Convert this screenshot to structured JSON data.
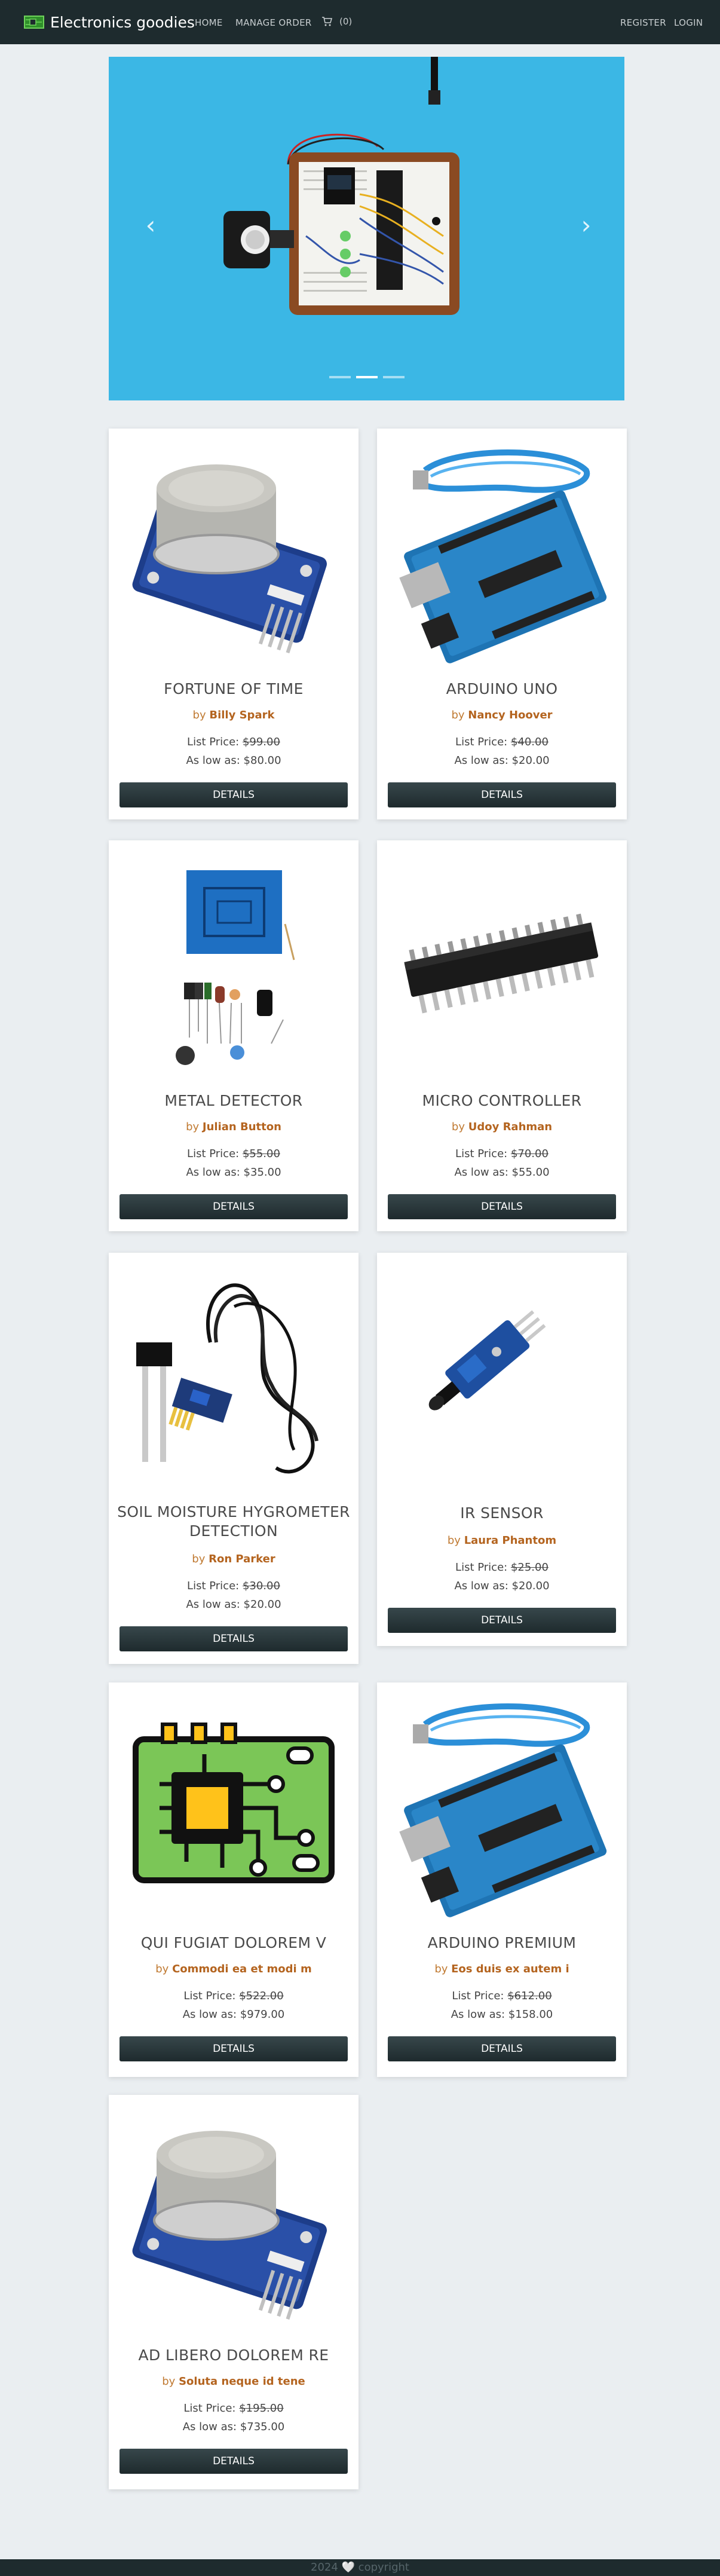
{
  "nav": {
    "brand": "Electronics goodies",
    "home": "HOME",
    "manage_order": "MANAGE ORDER",
    "cart_count": "(0)",
    "register": "REGISTER",
    "login": "LOGIN"
  },
  "carousel": {
    "prev": "‹",
    "next": "›",
    "slides": 3,
    "active_slide": 2
  },
  "products": [
    {
      "title": "FORTUNE OF TIME",
      "by": "by",
      "author": "Billy Spark",
      "list_label": "List Price:",
      "list_price": "$99.00",
      "low_label": "As low as:",
      "low_price": "$80.00",
      "button": "DETAILS",
      "image": "gas-sensor"
    },
    {
      "title": "ARDUINO UNO",
      "by": "by",
      "author": "Nancy Hoover",
      "list_label": "List Price:",
      "list_price": "$40.00",
      "low_label": "As low as:",
      "low_price": "$20.00",
      "button": "DETAILS",
      "image": "arduino-board"
    },
    {
      "title": "METAL DETECTOR",
      "by": "by",
      "author": "Julian Button",
      "list_label": "List Price:",
      "list_price": "$55.00",
      "low_label": "As low as:",
      "low_price": "$35.00",
      "button": "DETAILS",
      "image": "metal-detector-kit"
    },
    {
      "title": "MICRO CONTROLLER",
      "by": "by",
      "author": "Udoy Rahman",
      "list_label": "List Price:",
      "list_price": "$70.00",
      "low_label": "As low as:",
      "low_price": "$55.00",
      "button": "DETAILS",
      "image": "chip"
    },
    {
      "title": "SOIL MOISTURE HYGROMETER DETECTION",
      "by": "by",
      "author": "Ron Parker",
      "list_label": "List Price:",
      "list_price": "$30.00",
      "low_label": "As low as:",
      "low_price": "$20.00",
      "button": "DETAILS",
      "image": "soil-sensor"
    },
    {
      "title": "IR SENSOR",
      "by": "by",
      "author": "Laura Phantom",
      "list_label": "List Price:",
      "list_price": "$25.00",
      "low_label": "As low as:",
      "low_price": "$20.00",
      "button": "DETAILS",
      "image": "ir-sensor"
    },
    {
      "title": "QUI FUGIAT DOLOREM V",
      "by": "by",
      "author": "Commodi ea et modi m",
      "list_label": "List Price:",
      "list_price": "$522.00",
      "low_label": "As low as:",
      "low_price": "$979.00",
      "button": "DETAILS",
      "image": "circuit-icon"
    },
    {
      "title": "ARDUINO PREMIUM",
      "by": "by",
      "author": "Eos duis ex autem i",
      "list_label": "List Price:",
      "list_price": "$612.00",
      "low_label": "As low as:",
      "low_price": "$158.00",
      "button": "DETAILS",
      "image": "arduino-board"
    },
    {
      "title": "AD LIBERO DOLOREM RE",
      "by": "by",
      "author": "Soluta neque id tene",
      "list_label": "List Price:",
      "list_price": "$195.00",
      "low_label": "As low as:",
      "low_price": "$735.00",
      "button": "DETAILS",
      "image": "gas-sensor"
    }
  ],
  "footer": {
    "text": "2024 🤍 copyright"
  },
  "colors": {
    "navbar": "#1e2b2e",
    "accent": "#b4641f",
    "carousel_bg": "#3bb7e5"
  }
}
